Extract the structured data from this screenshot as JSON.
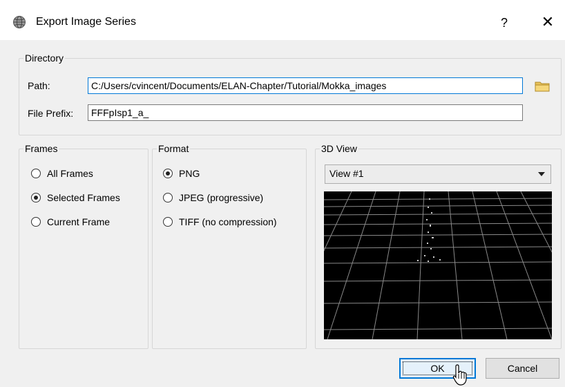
{
  "window": {
    "title": "Export Image Series",
    "help_label": "?",
    "close_label": "✕"
  },
  "directory": {
    "group_label": "Directory",
    "path_label": "Path:",
    "path_value": "C:/Users/cvincent/Documents/ELAN-Chapter/Tutorial/Mokka_images",
    "prefix_label": "File Prefix:",
    "prefix_value": "FFFpIsp1_a_",
    "browse_icon": "folder-icon"
  },
  "frames": {
    "group_label": "Frames",
    "options": [
      {
        "label": "All Frames",
        "checked": false
      },
      {
        "label": "Selected Frames",
        "checked": true
      },
      {
        "label": "Current Frame",
        "checked": false
      }
    ]
  },
  "format": {
    "group_label": "Format",
    "options": [
      {
        "label": "PNG",
        "checked": true
      },
      {
        "label": "JPEG (progressive)",
        "checked": false
      },
      {
        "label": "TIFF (no compression)",
        "checked": false
      }
    ]
  },
  "view3d": {
    "group_label": "3D View",
    "selected_view": "View #1"
  },
  "buttons": {
    "ok": "OK",
    "cancel": "Cancel"
  }
}
